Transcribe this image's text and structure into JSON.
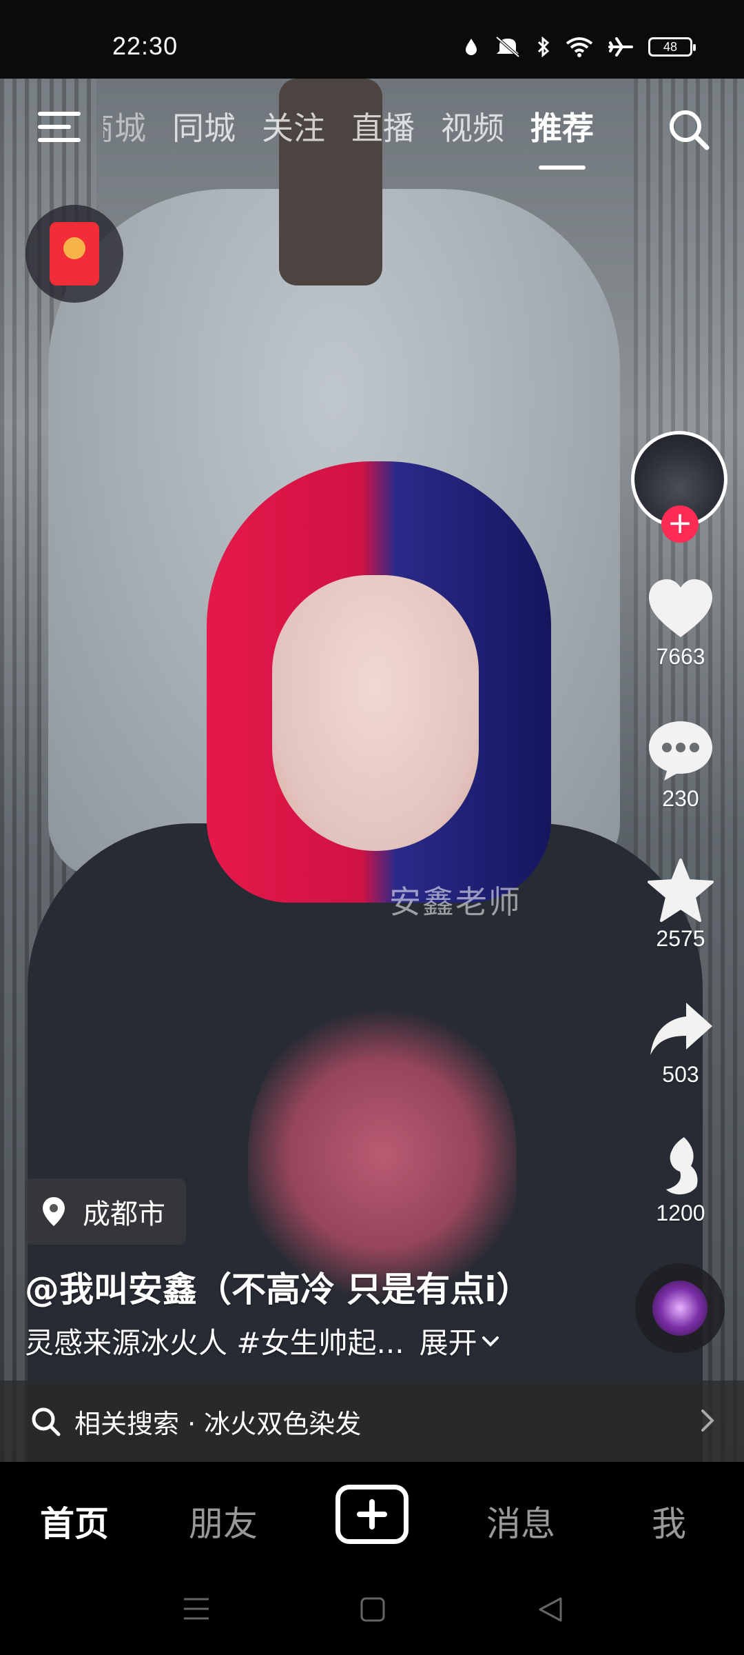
{
  "status_bar": {
    "time": "22:30",
    "battery": "48",
    "icons": [
      "water-drop-icon",
      "mute-icon",
      "bluetooth-icon",
      "wifi-icon",
      "airplane-icon",
      "battery-icon"
    ]
  },
  "top_nav": {
    "tabs": [
      {
        "label": "商城",
        "active": false
      },
      {
        "label": "同城",
        "active": false
      },
      {
        "label": "关注",
        "active": false
      },
      {
        "label": "直播",
        "active": false
      },
      {
        "label": "视频",
        "active": false
      },
      {
        "label": "推荐",
        "active": true
      }
    ]
  },
  "video": {
    "watermark": "安鑫老师"
  },
  "right_rail": {
    "likes": "7663",
    "comments": "230",
    "favorites": "2575",
    "shares": "503",
    "recommend": "1200"
  },
  "info": {
    "location": "成都市",
    "author": "@我叫安鑫（不高冷 只是有点i）",
    "description": "灵感来源冰火人 #女生帅起...",
    "expand_label": "展开"
  },
  "related_search": {
    "label": "相关搜索 · 冰火双色染发"
  },
  "tab_bar": {
    "home": "首页",
    "friends": "朋友",
    "messages": "消息",
    "me": "我"
  },
  "colors": {
    "accent": "#fe2c55",
    "background": "#000000"
  }
}
